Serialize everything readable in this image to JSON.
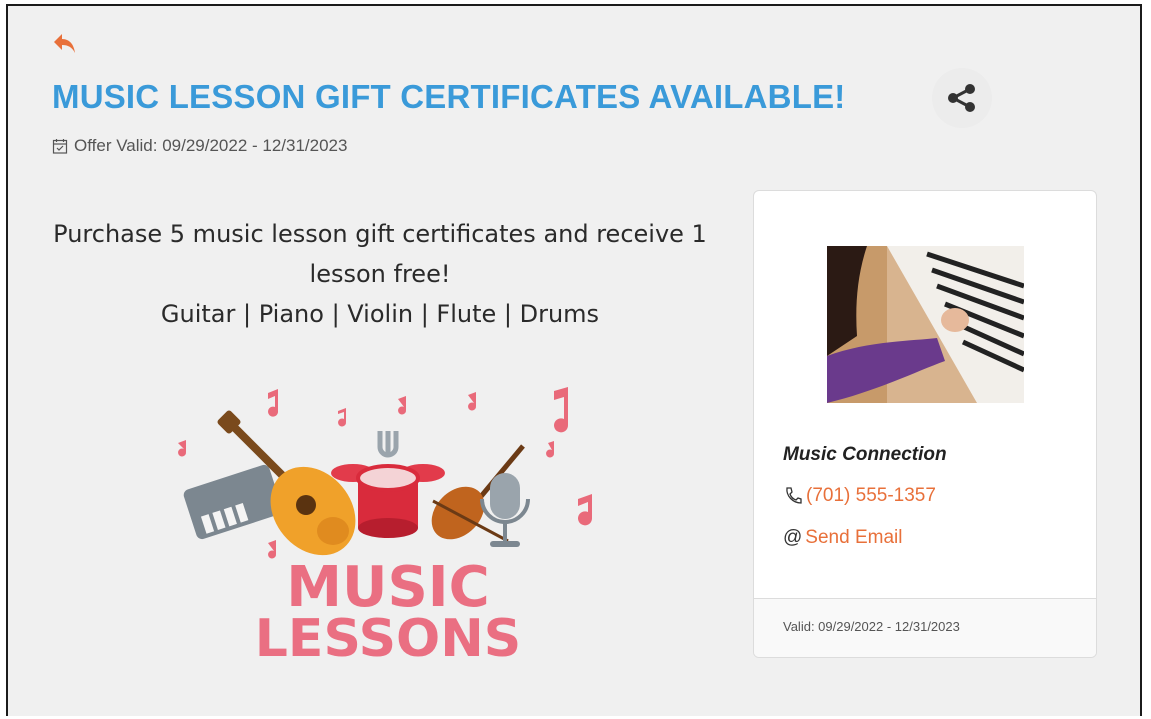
{
  "colors": {
    "accent": "#3a9ad9",
    "link": "#e8703a",
    "back_arrow": "#e8703a"
  },
  "header": {
    "back_icon": "reply-arrow-icon",
    "title": "MUSIC LESSON GIFT CERTIFICATES AVAILABLE!",
    "share_icon": "share-icon",
    "validity_icon": "calendar-check-icon",
    "validity_text": "Offer Valid: 09/29/2022 - 12/31/2023"
  },
  "description": {
    "line1": "Purchase 5 music lesson gift certificates and receive 1 lesson free!",
    "line2": "Guitar | Piano | Violin | Flute | Drums"
  },
  "artwork": {
    "word1": "MUSIC",
    "word2": "LESSONS"
  },
  "business_card": {
    "name": "Music Connection",
    "phone_icon": "phone-icon",
    "phone": "(701) 555-1357",
    "email_prefix": "@",
    "email_label": "Send Email",
    "footer": "Valid: 09/29/2022 - 12/31/2023"
  }
}
